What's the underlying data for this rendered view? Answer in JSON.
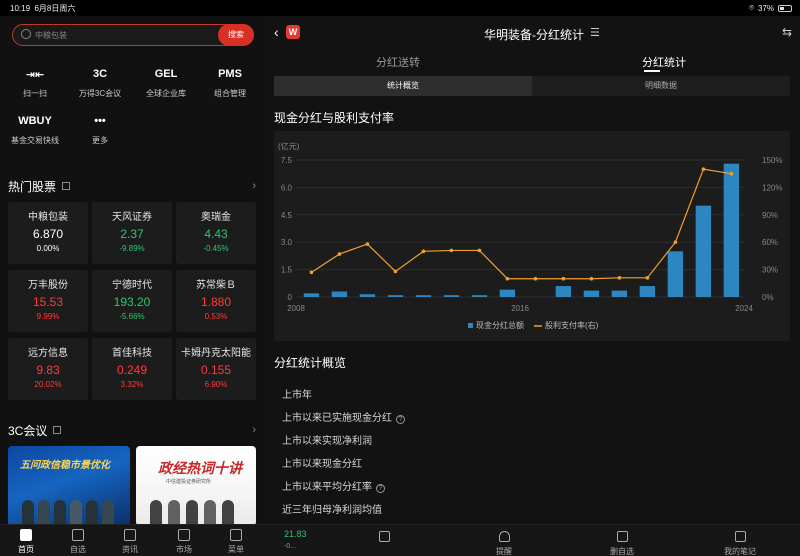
{
  "status": {
    "time": "10:19",
    "date": "6月8日周六",
    "battery": "37%"
  },
  "search": {
    "placeholder": "中粮包装",
    "button": "搜索"
  },
  "tools": [
    {
      "title": "⇥⇤",
      "label": "扫一扫"
    },
    {
      "title": "3C",
      "label": "万得3C会议"
    },
    {
      "title": "GEL",
      "label": "全球企业库"
    },
    {
      "title": "PMS",
      "label": "组合管理"
    },
    {
      "title": "WBUY",
      "label": "基金交易快线"
    },
    {
      "title": "•••",
      "label": "更多"
    }
  ],
  "hot": {
    "title": "热门股票",
    "stocks": [
      {
        "name": "中粮包装",
        "price": "6.870",
        "change": "0.00%",
        "color": "#ffffff"
      },
      {
        "name": "天风证券",
        "price": "2.37",
        "change": "-9.89%",
        "color": "#28c76f"
      },
      {
        "name": "奥瑞金",
        "price": "4.43",
        "change": "-0.45%",
        "color": "#28c76f"
      },
      {
        "name": "万丰股份",
        "price": "15.53",
        "change": "9.99%",
        "color": "#ff3b3b"
      },
      {
        "name": "宁德时代",
        "price": "193.20",
        "change": "-5.66%",
        "color": "#28c76f"
      },
      {
        "name": "苏常柴Ｂ",
        "price": "1.880",
        "change": "0.53%",
        "color": "#ff3b3b"
      },
      {
        "name": "远方信息",
        "price": "9.83",
        "change": "20.02%",
        "color": "#ff3b3b"
      },
      {
        "name": "首佳科技",
        "price": "0.249",
        "change": "3.32%",
        "color": "#ff3b3b"
      },
      {
        "name": "卡姆丹克太阳能",
        "price": "0.155",
        "change": "6.90%",
        "color": "#ff3b3b"
      }
    ]
  },
  "conf": {
    "title": "3C会议",
    "banner1": "五问政信稳市景优化",
    "banner2": "政经热词十讲",
    "banner2_sub": "中信建投证券研究所"
  },
  "tabbar": [
    "首页",
    "自选",
    "资讯",
    "市场",
    "菜单"
  ],
  "right": {
    "title": "华明装备-分红统计",
    "tabs": [
      "分红送转",
      "分红统计"
    ],
    "seg": [
      "统计概览",
      "明细数据"
    ],
    "chart_heading": "现金分红与股利支付率",
    "overview_heading": "分红统计概览",
    "rows": [
      "上市年",
      "上市以来已实施现金分红",
      "上市以来实现净利润",
      "上市以来现金分红",
      "上市以来平均分红率",
      "近三年归母净利润均值"
    ],
    "bottom": [
      "",
      "",
      "",
      "删自选",
      "我的笔记"
    ],
    "bottom_mid": "提醒",
    "quote_price": "21.83",
    "quote_change": "-0..."
  },
  "chart_data": {
    "type": "bar+line",
    "unit_left": "(亿元)",
    "x_ticks": [
      "2008",
      "2016",
      "2024"
    ],
    "y_left_ticks": [
      "0",
      "1.5",
      "3.0",
      "4.5",
      "6.0",
      "7.5"
    ],
    "y_right_ticks": [
      "0%",
      "30%",
      "60%",
      "90%",
      "120%",
      "150%"
    ],
    "ylim_left": [
      0,
      7.5
    ],
    "ylim_right": [
      0,
      150
    ],
    "legend_bar": "现金分红总额",
    "legend_line": "股利支付率(右)",
    "bar_color": "#2e86c1",
    "line_color": "#f0a030",
    "years": [
      2008,
      2009,
      2010,
      2011,
      2012,
      2013,
      2014,
      2015,
      2016,
      2017,
      2018,
      2019,
      2020,
      2021,
      2022,
      2023
    ],
    "bars": [
      0.2,
      0.3,
      0.15,
      0.1,
      0.1,
      0.1,
      0.1,
      0.4,
      0,
      0.6,
      0.35,
      0.35,
      0.6,
      2.5,
      5.0,
      7.3
    ],
    "payout": [
      27,
      47,
      58,
      28,
      50,
      51,
      51,
      20,
      20,
      20,
      20,
      21,
      21,
      60,
      140,
      135
    ]
  }
}
